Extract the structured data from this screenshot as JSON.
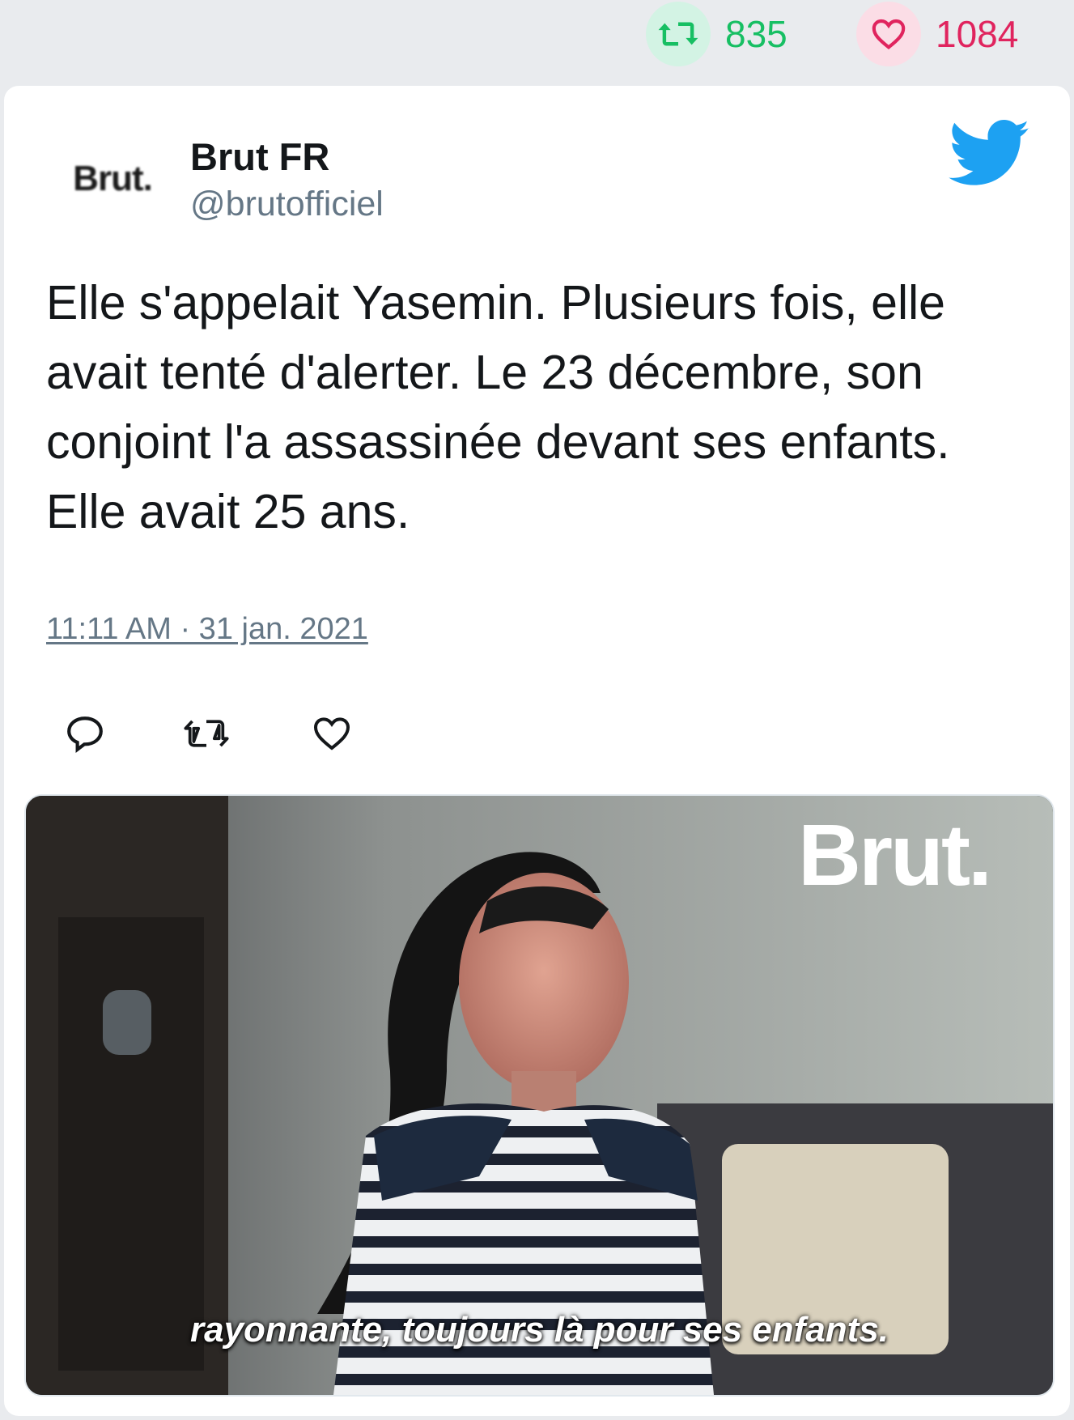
{
  "top_stats": {
    "retweets": "835",
    "likes": "1084",
    "retweet_icon": "retweet-icon",
    "like_icon": "heart-icon",
    "retweet_color": "#17bf63",
    "like_color": "#e0245e"
  },
  "tweet": {
    "author_name": "Brut FR",
    "author_handle": "@brutofficiel",
    "avatar_text": "Brut.",
    "text": "Elle s'appelait Yasemin. Plusieurs fois, elle avait tenté d'alerter. Le 23 décembre, son conjoint l'a assassinée devant ses enfants. Elle avait 25 ans.",
    "timestamp": "11:11 AM · 31 jan. 2021",
    "brand_icon": "twitter-bird-icon",
    "brand_color": "#1da1f2"
  },
  "actions": {
    "reply_icon": "reply-icon",
    "retweet_icon": "retweet-icon",
    "like_icon": "heart-icon"
  },
  "media": {
    "logo_text": "Brut.",
    "caption": "rayonnante, toujours là pour ses enfants."
  }
}
